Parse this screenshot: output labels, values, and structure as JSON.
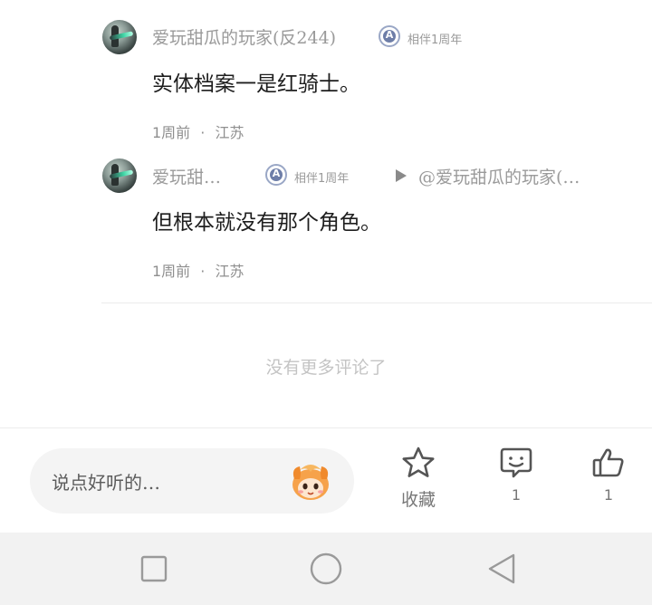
{
  "comments": [
    {
      "username": "爱玩甜瓜的玩家(反244)",
      "badge": "相伴1周年",
      "text": "实体档案一是红骑士。",
      "time": "1周前",
      "location": "江苏"
    },
    {
      "username": "爱玩甜…",
      "badge": "相伴1周年",
      "reply_to": "@爱玩甜瓜的玩家(…",
      "text": "但根本就没有那个角色。",
      "time": "1周前",
      "location": "江苏"
    }
  ],
  "meta_separator": "·",
  "no_more_text": "没有更多评论了",
  "bottom_bar": {
    "input_placeholder": "说点好听的…",
    "favorite_label": "收藏",
    "reply_count": "1",
    "like_count": "1"
  },
  "icons": {
    "favorite": "star-icon",
    "comment": "comment-smile-icon",
    "like": "thumbs-up-icon",
    "mascot": "mascot-emoji-icon",
    "nav_recent": "square-icon",
    "nav_home": "circle-icon",
    "nav_back": "triangle-back-icon"
  }
}
